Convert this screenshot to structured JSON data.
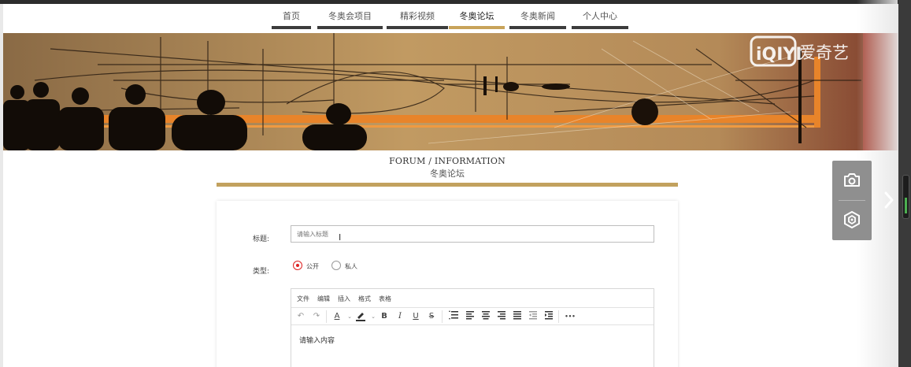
{
  "nav": {
    "items": [
      {
        "label": "首页",
        "active": false
      },
      {
        "label": "冬奥会项目",
        "active": false
      },
      {
        "label": "精彩视频",
        "active": false
      },
      {
        "label": "冬奥论坛",
        "active": true
      },
      {
        "label": "冬奥新闻",
        "active": false
      },
      {
        "label": "个人中心",
        "active": false
      }
    ]
  },
  "banner": {
    "watermark_logo": "iQIYI",
    "watermark_text": "爱奇艺"
  },
  "heading": {
    "en": "FORUM / INFORMATION",
    "cn": "冬奥论坛"
  },
  "form": {
    "title_label": "标题:",
    "title_placeholder": "请输入标题",
    "type_label": "类型:",
    "type_options": [
      {
        "label": "公开",
        "checked": true
      },
      {
        "label": "私人",
        "checked": false
      }
    ],
    "editor": {
      "menu": [
        "文件",
        "编辑",
        "插入",
        "格式",
        "表格"
      ],
      "toolbar_icons": [
        "undo-icon",
        "redo-icon",
        "font-color-icon",
        "highlight-icon",
        "bold-icon",
        "italic-icon",
        "underline-icon",
        "strikethrough-icon",
        "line-height-icon",
        "align-left-icon",
        "align-center-icon",
        "align-right-icon",
        "align-justify-icon",
        "outdent-icon",
        "indent-icon",
        "more-icon"
      ],
      "toolbar_glyphs": {
        "undo": "↶",
        "redo": "↷",
        "font_color": "A",
        "bold": "B",
        "italic": "I",
        "underline": "U",
        "strike": "S",
        "more": "•••"
      },
      "content_placeholder": "请输入内容"
    }
  },
  "float_panel": {
    "icons": [
      "camera-icon",
      "target-icon"
    ]
  },
  "colors": {
    "accent_gold": "#c2a15e",
    "nav_bar": "#3c3c3c",
    "radio_checked": "#dd2222",
    "float_panel": "#8f8f8f"
  }
}
